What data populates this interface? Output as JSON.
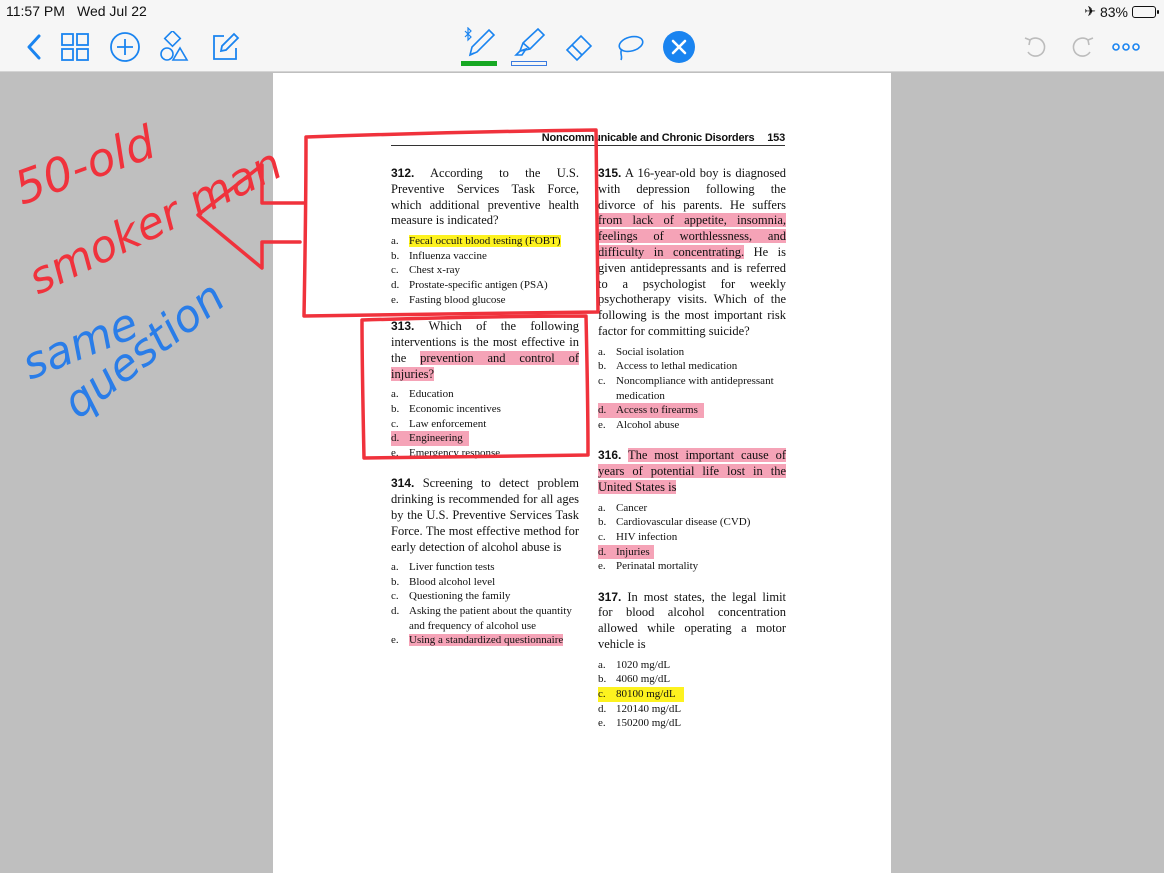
{
  "status_bar": {
    "time": "11:57 PM",
    "date": "Wed Jul 22",
    "battery_percent": "83%",
    "battery_level": 0.83
  },
  "toolbar": {
    "left_icons": [
      "back-chevron-icon",
      "thumbnail-grid-icon",
      "add-circle-icon",
      "shapes-icon",
      "compose-icon"
    ],
    "tools": [
      "bluetooth-pen-icon",
      "highlighter-icon",
      "eraser-icon",
      "lasso-icon",
      "close-tool-icon"
    ],
    "right_icons": [
      "undo-icon",
      "redo-icon",
      "more-icon"
    ],
    "colors": {
      "pen_underline": "#17a823",
      "highlighter_underline": "#3a7be0",
      "accent": "#1a84f0",
      "close_bg": "#1a84f0"
    }
  },
  "document": {
    "running_head": {
      "title": "Noncommunicable and Chronic Disorders",
      "page": "153"
    },
    "left_column": [
      {
        "number": "312.",
        "stem": "According to the U.S. Preventive Services Task Force, which additional preventive health measure is indicated?",
        "options": [
          {
            "letter": "a.",
            "text": "Fecal occult blood testing (FOBT)",
            "highlight": "yellow"
          },
          {
            "letter": "b.",
            "text": "Influenza vaccine",
            "highlight": ""
          },
          {
            "letter": "c.",
            "text": "Chest x-ray",
            "highlight": ""
          },
          {
            "letter": "d.",
            "text": "Prostate-specific antigen (PSA)",
            "highlight": ""
          },
          {
            "letter": "e.",
            "text": "Fasting blood glucose",
            "highlight": ""
          }
        ]
      },
      {
        "number": "313.",
        "stem_plain": "Which of the following interventions is the most effective in the",
        "stem_highlight": "prevention and control of injuries?",
        "options": [
          {
            "letter": "a.",
            "text": "Education",
            "highlight": ""
          },
          {
            "letter": "b.",
            "text": "Economic incentives",
            "highlight": ""
          },
          {
            "letter": "c.",
            "text": "Law enforcement",
            "highlight": ""
          },
          {
            "letter": "d.",
            "text": "Engineering",
            "highlight": "pink"
          },
          {
            "letter": "e.",
            "text": "Emergency response",
            "highlight": ""
          }
        ]
      },
      {
        "number": "314.",
        "stem": "Screening to detect problem drinking is recommended for all ages by the U.S. Preventive Services Task Force. The most effective method for early detection of alcohol abuse is",
        "options": [
          {
            "letter": "a.",
            "text": "Liver function tests",
            "highlight": ""
          },
          {
            "letter": "b.",
            "text": "Blood alcohol level",
            "highlight": ""
          },
          {
            "letter": "c.",
            "text": "Questioning the family",
            "highlight": ""
          },
          {
            "letter": "d.",
            "text": "Asking the patient about the quantity and frequency of alcohol use",
            "highlight": ""
          },
          {
            "letter": "e.",
            "text": "Using a standardized questionnaire",
            "highlight": "pink"
          }
        ]
      }
    ],
    "right_column": [
      {
        "number": "315.",
        "stem_a": "A 16-year-old boy is diagnosed with depression following the divorce of his parents. He suffers",
        "stem_highlight": "from lack of appetite, insomnia, feelings of worthlessness, and difficulty in concentrating.",
        "stem_b": "He is given antidepressants and is referred to a psychologist for weekly psychotherapy visits. Which of the following is the most important risk factor for committing suicide?",
        "options": [
          {
            "letter": "a.",
            "text": "Social isolation",
            "highlight": ""
          },
          {
            "letter": "b.",
            "text": "Access to lethal medication",
            "highlight": ""
          },
          {
            "letter": "c.",
            "text": "Noncompliance with antidepressant medication",
            "highlight": ""
          },
          {
            "letter": "d.",
            "text": "Access to firearms",
            "highlight": "pink"
          },
          {
            "letter": "e.",
            "text": "Alcohol abuse",
            "highlight": ""
          }
        ]
      },
      {
        "number": "316.",
        "stem_highlight": "The most important cause of years of potential life lost in the United States is",
        "options": [
          {
            "letter": "a.",
            "text": "Cancer",
            "highlight": ""
          },
          {
            "letter": "b.",
            "text": "Cardiovascular disease (CVD)",
            "highlight": ""
          },
          {
            "letter": "c.",
            "text": "HIV infection",
            "highlight": ""
          },
          {
            "letter": "d.",
            "text": "Injuries",
            "highlight": "pink"
          },
          {
            "letter": "e.",
            "text": "Perinatal mortality",
            "highlight": ""
          }
        ]
      },
      {
        "number": "317.",
        "stem": "In most states, the legal limit for blood alcohol concentration allowed while operating a motor vehicle is",
        "options": [
          {
            "letter": "a.",
            "text": "1020 mg/dL",
            "highlight": ""
          },
          {
            "letter": "b.",
            "text": "4060 mg/dL",
            "highlight": ""
          },
          {
            "letter": "c.",
            "text": "80100 mg/dL",
            "highlight": "yellow"
          },
          {
            "letter": "d.",
            "text": "120140 mg/dL",
            "highlight": ""
          },
          {
            "letter": "e.",
            "text": "150200 mg/dL",
            "highlight": ""
          }
        ]
      }
    ]
  },
  "handwriting": {
    "red_note": "50-old smoker man",
    "blue_note": "same question",
    "red_color": "#f0323c",
    "blue_color": "#2a7de8"
  }
}
